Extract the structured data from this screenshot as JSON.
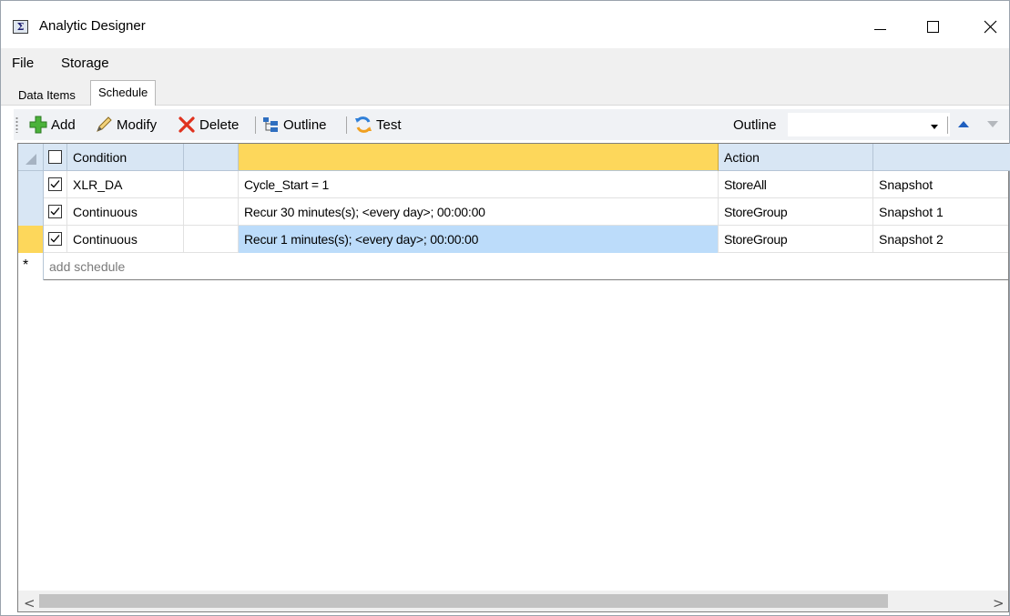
{
  "window": {
    "title": "Analytic Designer",
    "icon_glyph": "Σ"
  },
  "menu": {
    "file": "File",
    "storage": "Storage"
  },
  "tabs": [
    {
      "label": "Data Items",
      "active": false
    },
    {
      "label": "Schedule",
      "active": true
    }
  ],
  "toolbar": {
    "add": "Add",
    "modify": "Modify",
    "delete": "Delete",
    "outline": "Outline",
    "test": "Test",
    "outline_label": "Outline",
    "outline_value": ""
  },
  "grid": {
    "headers": {
      "condition": "Condition",
      "blank": "",
      "schedule": "",
      "action": "Action",
      "name": ""
    },
    "rows": [
      {
        "checked": true,
        "condition": "XLR_DA",
        "blank": "",
        "schedule": "Cycle_Start = 1",
        "action": "StoreAll",
        "name": "Snapshot",
        "current": false
      },
      {
        "checked": true,
        "condition": "Continuous",
        "blank": "",
        "schedule": "Recur 30 minutes(s); <every day>; 00:00:00",
        "action": "StoreGroup",
        "name": "Snapshot 1",
        "current": false
      },
      {
        "checked": true,
        "condition": "Continuous",
        "blank": "",
        "schedule": "Recur 1 minutes(s); <every day>; 00:00:00",
        "action": "StoreGroup",
        "name": "Snapshot 2",
        "current": true
      }
    ],
    "new_row_glyph": "*",
    "new_row_placeholder": "add schedule"
  },
  "colors": {
    "header_bg": "#d8e6f4",
    "active_header": "#fdd75b",
    "selection": "#bcdcfa",
    "accent_blue": "#1f5fbf"
  }
}
